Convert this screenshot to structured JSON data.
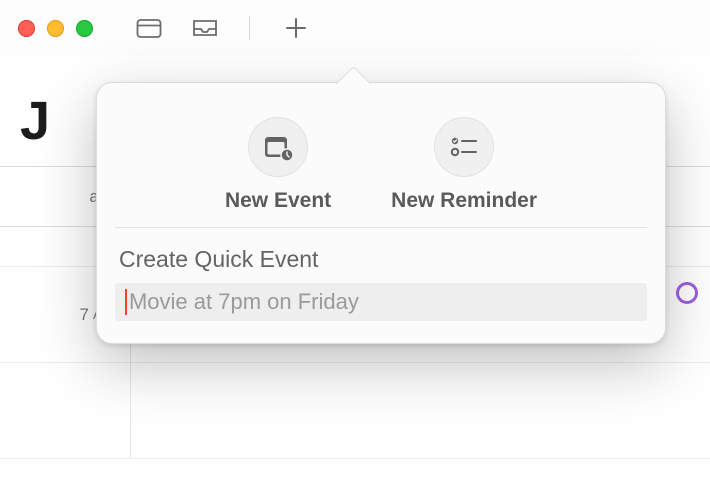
{
  "toolbar": {
    "icons": {
      "calendars": "calendars-icon",
      "inbox": "inbox-icon",
      "add": "plus-icon"
    }
  },
  "heading": {
    "month_partial": "J"
  },
  "calendar": {
    "allday_label": "all-",
    "hours": [
      {
        "num": "7",
        "ampm": "AM"
      }
    ]
  },
  "popover": {
    "modes": {
      "event_label": "New Event",
      "reminder_label": "New Reminder"
    },
    "quick_label": "Create Quick Event",
    "quick_placeholder": "Movie at 7pm on Friday",
    "quick_value": ""
  }
}
